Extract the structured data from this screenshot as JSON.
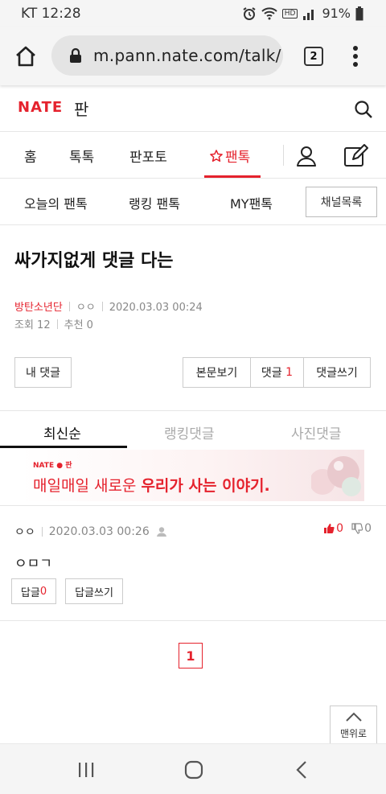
{
  "status_bar": {
    "carrier_time": "KT 12:28",
    "hd_label": "HD",
    "battery": "91%"
  },
  "browser": {
    "url": "m.pann.nate.com/talk/",
    "tab_count": "2"
  },
  "site": {
    "logo": "NATE",
    "logo_sub": "판"
  },
  "main_nav": {
    "items": [
      "홈",
      "톡톡",
      "판포토",
      "팬톡"
    ],
    "active": "팬톡",
    "accent": "#e5222d"
  },
  "sub_nav": {
    "items": [
      "오늘의 팬톡",
      "랭킹 팬톡",
      "MY팬톡"
    ],
    "channel_button": "채널목록"
  },
  "post": {
    "title": "싸가지없게 댓글 다는",
    "category": "방탄소년단",
    "author": "ㅇㅇ",
    "datetime": "2020.03.03 00:24",
    "views": "조회 12",
    "recommends": "추천 0"
  },
  "post_actions": {
    "my_comments": "내 댓글",
    "view_body": "본문보기",
    "comments_label": "댓글",
    "comments_count": "1",
    "write_comment": "댓글쓰기"
  },
  "comment_tabs": {
    "items": [
      "최신순",
      "랭킹댓글",
      "사진댓글"
    ],
    "active": "최신순"
  },
  "ad": {
    "logo": "NATE ● 판",
    "text_plain": "매일매일 새로운",
    "text_bold": "우리가 사는 이야기."
  },
  "comment": {
    "author": "ㅇㅇ",
    "datetime": "2020.03.03 00:26",
    "up": "0",
    "down": "0",
    "body": "ㅇㅁㄱ",
    "reply_label": "답글",
    "reply_count": "0",
    "write_reply": "답글쓰기"
  },
  "pagination": {
    "current": "1"
  },
  "top_button": {
    "label": "맨위로"
  }
}
